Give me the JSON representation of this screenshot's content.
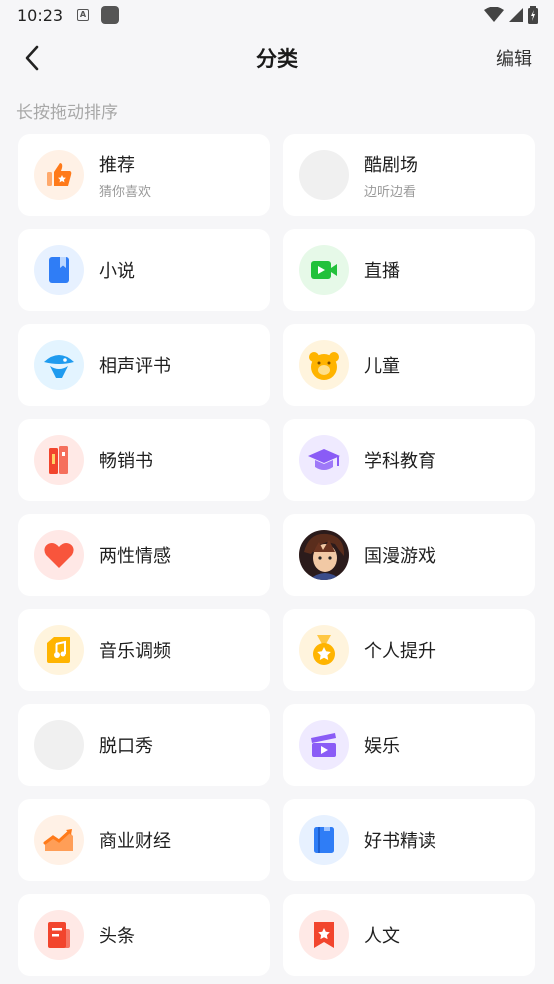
{
  "status_bar": {
    "time": "10:23",
    "a_glyph": "A"
  },
  "header": {
    "title": "分类",
    "edit_label": "编辑"
  },
  "hint": "长按拖动排序",
  "categories": [
    {
      "title": "推荐",
      "subtitle": "猜你喜欢",
      "icon": "thumbs-up-star-icon",
      "bg": "#fff1e6",
      "color": "#ff7a1a"
    },
    {
      "title": "酷剧场",
      "subtitle": "边听边看",
      "icon": "blank-icon",
      "bg": "#f0f0f0",
      "color": "#f0f0f0"
    },
    {
      "title": "小说",
      "subtitle": "",
      "icon": "book-bookmark-icon",
      "bg": "#e7f1ff",
      "color": "#2f7df6"
    },
    {
      "title": "直播",
      "subtitle": "",
      "icon": "video-camera-icon",
      "bg": "#e6f9e8",
      "color": "#22c13b"
    },
    {
      "title": "相声评书",
      "subtitle": "",
      "icon": "fan-icon",
      "bg": "#e3f4ff",
      "color": "#1f9bef"
    },
    {
      "title": "儿童",
      "subtitle": "",
      "icon": "bear-face-icon",
      "bg": "#fff4dd",
      "color": "#ffb400"
    },
    {
      "title": "畅销书",
      "subtitle": "",
      "icon": "books-icon",
      "bg": "#ffe9e6",
      "color": "#f2452d"
    },
    {
      "title": "学科教育",
      "subtitle": "",
      "icon": "graduation-cap-icon",
      "bg": "#efeaff",
      "color": "#8a5cf6"
    },
    {
      "title": "两性情感",
      "subtitle": "",
      "icon": "heart-icon",
      "bg": "#ffe8e6",
      "color": "#f8553c"
    },
    {
      "title": "国漫游戏",
      "subtitle": "",
      "icon": "anime-character-icon",
      "bg": "#f3e6e6",
      "color": "#6b2a2a"
    },
    {
      "title": "音乐调频",
      "subtitle": "",
      "icon": "music-note-icon",
      "bg": "#fff4dd",
      "color": "#ffb400"
    },
    {
      "title": "个人提升",
      "subtitle": "",
      "icon": "medal-icon",
      "bg": "#fff4dd",
      "color": "#ffb400"
    },
    {
      "title": "脱口秀",
      "subtitle": "",
      "icon": "blank-icon",
      "bg": "#f0f0f0",
      "color": "#f0f0f0"
    },
    {
      "title": "娱乐",
      "subtitle": "",
      "icon": "clapperboard-icon",
      "bg": "#efeaff",
      "color": "#8a5cf6"
    },
    {
      "title": "商业财经",
      "subtitle": "",
      "icon": "trend-chart-icon",
      "bg": "#fff1e6",
      "color": "#ff7a1a"
    },
    {
      "title": "好书精读",
      "subtitle": "",
      "icon": "blue-book-icon",
      "bg": "#e7f1ff",
      "color": "#2f7df6"
    },
    {
      "title": "头条",
      "subtitle": "",
      "icon": "news-page-icon",
      "bg": "#ffe9e6",
      "color": "#f2452d"
    },
    {
      "title": "人文",
      "subtitle": "",
      "icon": "bookmark-star-icon",
      "bg": "#ffe9e6",
      "color": "#f2452d"
    }
  ]
}
